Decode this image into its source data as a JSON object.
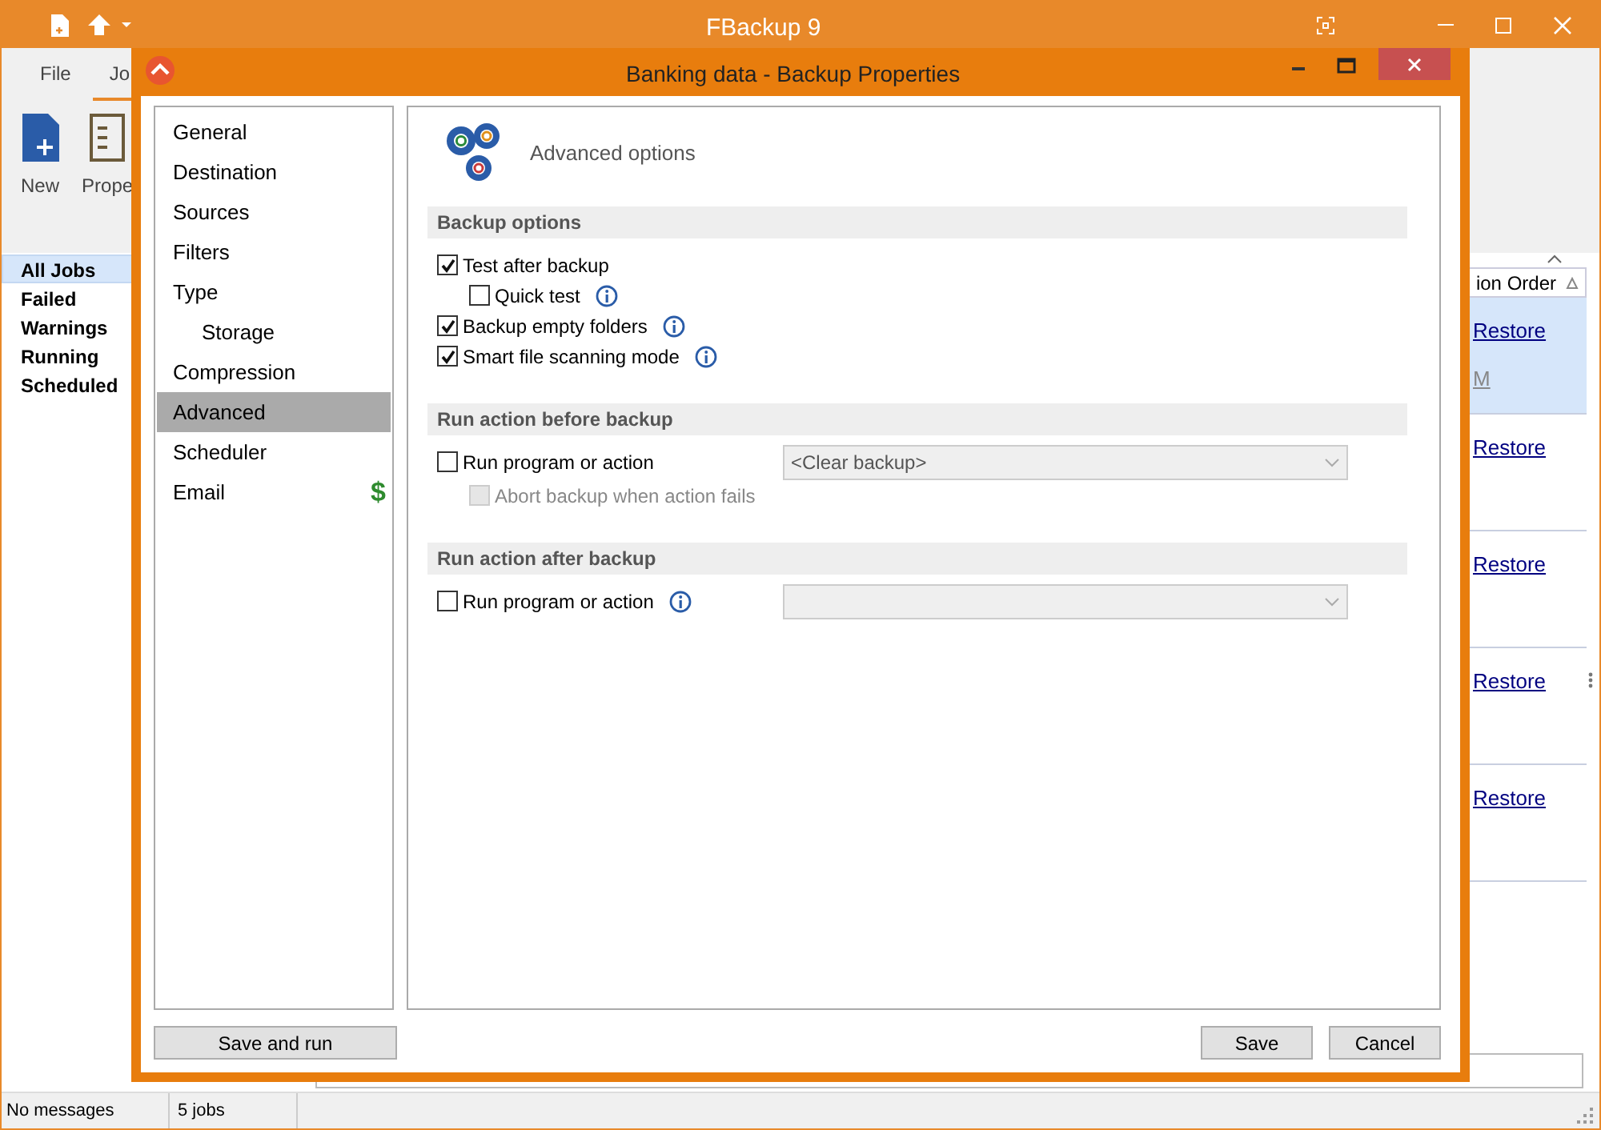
{
  "app": {
    "title": "FBackup 9",
    "ribbon_tabs": [
      {
        "label": "File",
        "selected": false
      },
      {
        "label": "Jo",
        "selected": true
      }
    ],
    "ribbon_buttons": [
      {
        "label": "New",
        "kind": "new"
      },
      {
        "label": "Prope",
        "kind": "properties"
      }
    ],
    "job_filters": [
      {
        "label": "All Jobs",
        "selected": true
      },
      {
        "label": "Failed",
        "selected": false
      },
      {
        "label": "Warnings",
        "selected": false
      },
      {
        "label": "Running",
        "selected": false
      },
      {
        "label": "Scheduled",
        "selected": false
      }
    ],
    "table": {
      "column_header": "ion Order",
      "rows": [
        {
          "link": "Restore",
          "selected": true,
          "column_2": "M"
        },
        {
          "link": "Restore",
          "selected": false
        },
        {
          "link": "Restore",
          "selected": false
        },
        {
          "link": "Restore",
          "selected": false
        },
        {
          "link": "Restore",
          "selected": false
        }
      ]
    },
    "status_bar": [
      "No messages",
      "5 jobs"
    ]
  },
  "dialog": {
    "title": "Banking data - Backup Properties",
    "nav": [
      {
        "label": "General",
        "selected": false
      },
      {
        "label": "Destination",
        "selected": false
      },
      {
        "label": "Sources",
        "selected": false
      },
      {
        "label": "Filters",
        "selected": false
      },
      {
        "label": "Type",
        "selected": false,
        "children": [
          {
            "label": "Storage",
            "selected": false
          }
        ]
      },
      {
        "label": "Compression",
        "selected": false
      },
      {
        "label": "Advanced",
        "selected": true
      },
      {
        "label": "Scheduler",
        "selected": false
      },
      {
        "label": "Email",
        "selected": false,
        "badge": "$"
      }
    ],
    "heading": "Advanced options",
    "sections": [
      {
        "title": "Backup options",
        "options": [
          {
            "label": "Test after backup",
            "checked": true,
            "disabled": false,
            "info": false,
            "children": [
              {
                "label": "Quick test",
                "checked": false,
                "disabled": false,
                "info": true
              }
            ]
          },
          {
            "label": "Backup empty folders",
            "checked": true,
            "disabled": false,
            "info": true
          },
          {
            "label": "Smart file scanning mode",
            "checked": true,
            "disabled": false,
            "info": true
          }
        ]
      },
      {
        "title": "Run action before backup",
        "options": [
          {
            "label": "Run program or action",
            "checked": false,
            "disabled": false,
            "info": false,
            "dropdown": {
              "value": "<Clear backup>",
              "disabled": true
            },
            "children": [
              {
                "label": "Abort backup when action fails",
                "checked": false,
                "disabled": true,
                "info": false
              }
            ]
          }
        ]
      },
      {
        "title": "Run action after backup",
        "options": [
          {
            "label": "Run program or action",
            "checked": false,
            "disabled": false,
            "info": true,
            "dropdown": {
              "disabled": true
            }
          }
        ]
      }
    ],
    "buttons": {
      "left": "Save and run",
      "right": [
        "Save",
        "Cancel"
      ]
    }
  }
}
